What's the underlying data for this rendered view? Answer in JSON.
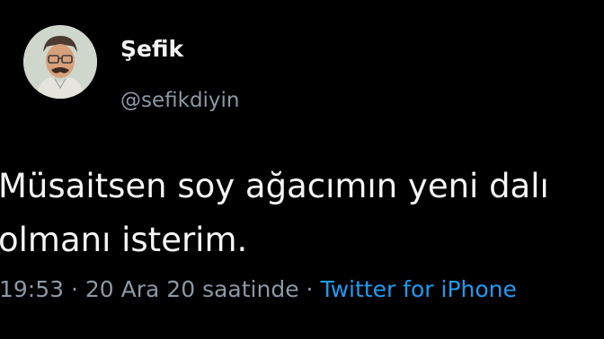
{
  "author": {
    "display_name": "Şefik",
    "handle": "@sefikdiyin",
    "avatar_icon": "cartoon-man-avatar"
  },
  "tweet": {
    "text": "Müsaitsen soy ağacımın yeni dalı\nolmanı isterim."
  },
  "meta": {
    "time": "19:53",
    "separator": "·",
    "date": "20 Ara 20 saatinde",
    "source": "Twitter for iPhone"
  },
  "colors": {
    "background": "#000000",
    "text": "#f5f5f5",
    "muted": "#8b98a5",
    "link": "#1d9bf0"
  }
}
